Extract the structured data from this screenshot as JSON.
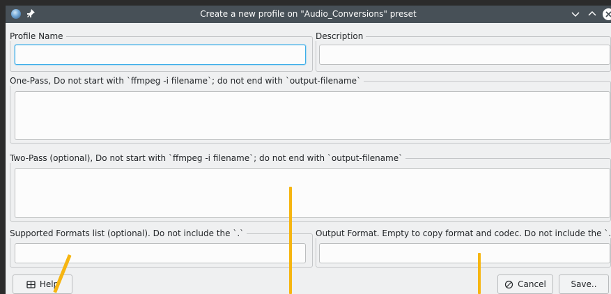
{
  "titlebar": {
    "title": "Create a new profile on \"Audio_Conversions\" preset"
  },
  "form": {
    "profile_name": {
      "label": "Profile Name",
      "value": "",
      "placeholder": ""
    },
    "description": {
      "label": "Description",
      "value": "",
      "placeholder": ""
    },
    "one_pass": {
      "label": "One-Pass, Do not start with `ffmpeg -i filename`; do not end with `output-filename`",
      "value": ""
    },
    "two_pass": {
      "label": "Two-Pass (optional), Do not start with `ffmpeg -i filename`; do not end with `output-filename`",
      "value": ""
    },
    "supported_formats": {
      "label": "Supported Formats list (optional). Do not include the `.`",
      "value": ""
    },
    "output_format": {
      "label": "Output Format. Empty to copy format and codec. Do not include the `.`",
      "value": ""
    }
  },
  "buttons": {
    "help": "Help",
    "cancel": "Cancel",
    "save": "Save.."
  },
  "icons": {
    "app": "app-globe-icon",
    "pin": "pin-icon",
    "minimize": "chevron-down-icon",
    "maximize": "chevron-up-icon",
    "close": "close-icon",
    "help": "help-icon",
    "cancel": "cancel-icon"
  },
  "colors": {
    "titlebar": "#475057",
    "window_bg": "#eff0f1",
    "focus": "#3daee9",
    "annotation": "#f6b511"
  }
}
